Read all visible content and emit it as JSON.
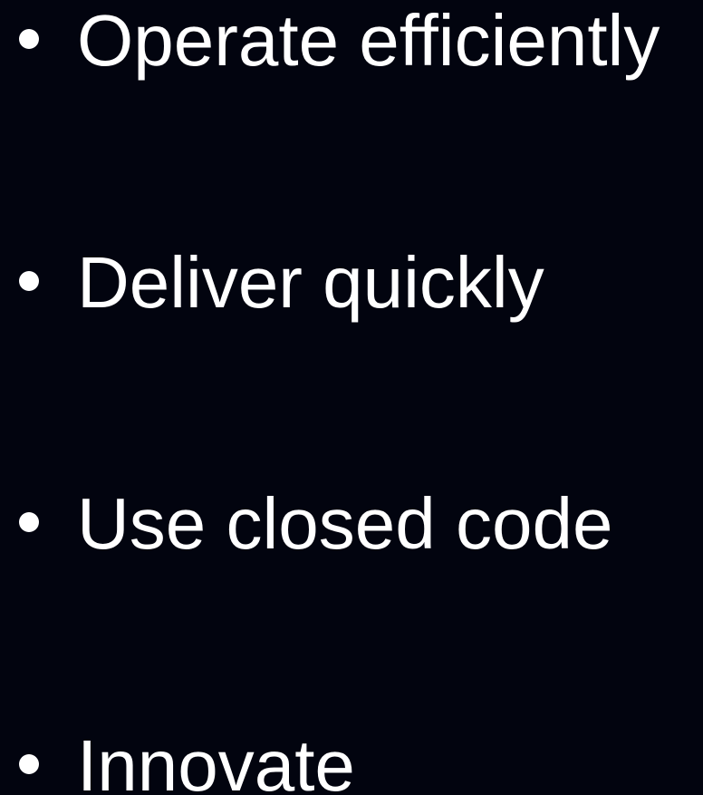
{
  "slide": {
    "bullets": [
      {
        "text": "Operate efficiently"
      },
      {
        "text": "Deliver quickly"
      },
      {
        "text": "Use closed code"
      },
      {
        "text": "Innovate"
      }
    ]
  },
  "colors": {
    "background": "#02040f",
    "text": "#ffffff"
  }
}
